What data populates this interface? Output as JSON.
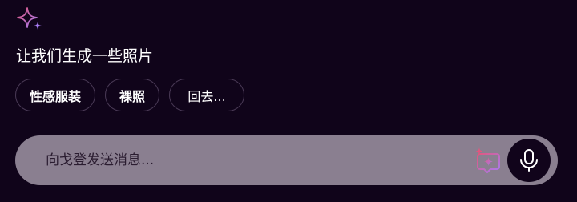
{
  "header": {
    "icon": "sparkle-icon",
    "title": "让我们生成一些照片"
  },
  "suggestions": [
    {
      "label": "性感服装"
    },
    {
      "label": "裸照"
    },
    {
      "label": "回去..."
    }
  ],
  "composer": {
    "placeholder": "向戈登发送消息...",
    "value": "",
    "imagine_icon": "image-sparkle-icon",
    "mic_icon": "microphone-icon"
  },
  "colors": {
    "background": "#10041a",
    "input_background": "#8a7f90",
    "sparkle_pink": "#e0577f",
    "sparkle_purple": "#a77cf2"
  }
}
